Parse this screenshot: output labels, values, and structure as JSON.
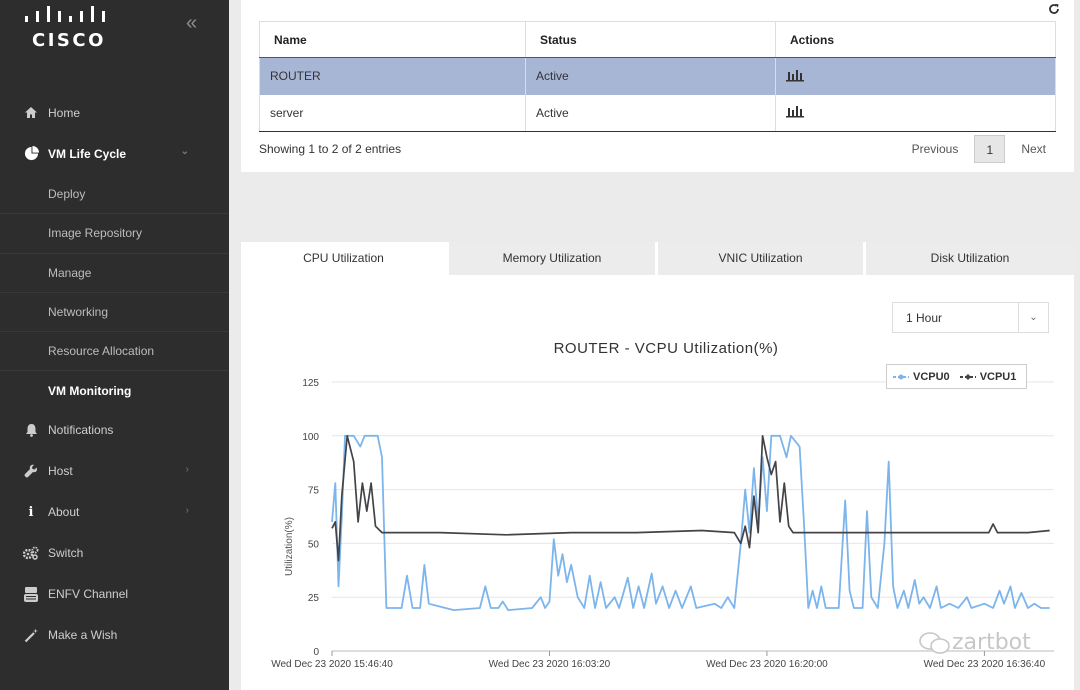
{
  "sidebar": {
    "logo_text": "CISCO",
    "collapse_glyph": "«",
    "items": [
      {
        "label": "Home",
        "icon": "home-icon"
      },
      {
        "label": "VM Life Cycle",
        "icon": "pie-chart-icon",
        "expanded": true,
        "children": [
          "Deploy",
          "Image Repository",
          "Manage",
          "Networking",
          "Resource Allocation",
          "VM Monitoring"
        ],
        "active_child": "VM Monitoring"
      },
      {
        "label": "Notifications",
        "icon": "bell-icon"
      },
      {
        "label": "Host",
        "icon": "wrench-icon",
        "has_submenu": true
      },
      {
        "label": "About",
        "icon": "info-icon",
        "has_submenu": true
      },
      {
        "label": "Switch",
        "icon": "gears-icon"
      },
      {
        "label": "ENFV Channel",
        "icon": "youtube-icon"
      },
      {
        "label": "Make a Wish",
        "icon": "magic-wand-icon"
      }
    ]
  },
  "vm_table": {
    "headers": [
      "Name",
      "Status",
      "Actions"
    ],
    "rows": [
      {
        "name": "ROUTER",
        "status": "Active",
        "selected": true
      },
      {
        "name": "server",
        "status": "Active",
        "selected": false
      }
    ],
    "showing": "Showing 1 to 2 of 2 entries",
    "pager": {
      "previous": "Previous",
      "page": "1",
      "next": "Next"
    }
  },
  "tabs": [
    {
      "label": "CPU Utilization",
      "active": true
    },
    {
      "label": "Memory Utilization",
      "active": false
    },
    {
      "label": "VNIC Utilization",
      "active": false
    },
    {
      "label": "Disk Utilization",
      "active": false
    }
  ],
  "time_range": {
    "selected": "1 Hour"
  },
  "colors": {
    "vcpu0": "#7cb5ec",
    "vcpu1": "#434348",
    "selected_row": "#a8b6d6",
    "sidebar": "#2d2d2d"
  },
  "watermark": "zartbot",
  "chart_data": {
    "type": "line",
    "title": "ROUTER - VCPU Utilization(%)",
    "ylabel": "Utilization(%)",
    "xlabel": "",
    "ylim": [
      0,
      125
    ],
    "yticks": [
      0,
      25,
      50,
      75,
      100,
      125
    ],
    "xlim": [
      "Wed Dec 23 2020 15:46:40",
      "Wed Dec 23 2020 16:42:00"
    ],
    "xticks": [
      "Wed Dec 23 2020 15:46:40",
      "Wed Dec 23 2020 16:03:20",
      "Wed Dec 23 2020 16:20:00",
      "Wed Dec 23 2020 16:36:40"
    ],
    "grid": true,
    "legend": "top-right",
    "series": [
      {
        "name": "VCPU0",
        "points": [
          [
            "Wed Dec 23 2020 15:46:40",
            60
          ],
          [
            "Wed Dec 23 2020 15:46:55",
            78
          ],
          [
            "Wed Dec 23 2020 15:47:10",
            30
          ],
          [
            "Wed Dec 23 2020 15:47:25",
            62
          ],
          [
            "Wed Dec 23 2020 15:47:40",
            100
          ],
          [
            "Wed Dec 23 2020 15:48:20",
            100
          ],
          [
            "Wed Dec 23 2020 15:48:50",
            95
          ],
          [
            "Wed Dec 23 2020 15:49:10",
            100
          ],
          [
            "Wed Dec 23 2020 15:50:10",
            100
          ],
          [
            "Wed Dec 23 2020 15:50:30",
            90
          ],
          [
            "Wed Dec 23 2020 15:50:50",
            20
          ],
          [
            "Wed Dec 23 2020 15:52:00",
            20
          ],
          [
            "Wed Dec 23 2020 15:52:25",
            35
          ],
          [
            "Wed Dec 23 2020 15:52:50",
            20
          ],
          [
            "Wed Dec 23 2020 15:53:25",
            20
          ],
          [
            "Wed Dec 23 2020 15:53:45",
            40
          ],
          [
            "Wed Dec 23 2020 15:54:05",
            22
          ],
          [
            "Wed Dec 23 2020 15:56:00",
            19
          ],
          [
            "Wed Dec 23 2020 15:58:00",
            20
          ],
          [
            "Wed Dec 23 2020 15:58:25",
            30
          ],
          [
            "Wed Dec 23 2020 15:58:50",
            20
          ],
          [
            "Wed Dec 23 2020 15:59:25",
            20
          ],
          [
            "Wed Dec 23 2020 15:59:45",
            23
          ],
          [
            "Wed Dec 23 2020 16:00:10",
            19
          ],
          [
            "Wed Dec 23 2020 16:02:00",
            20
          ],
          [
            "Wed Dec 23 2020 16:02:40",
            25
          ],
          [
            "Wed Dec 23 2020 16:03:00",
            20
          ],
          [
            "Wed Dec 23 2020 16:03:20",
            23
          ],
          [
            "Wed Dec 23 2020 16:03:40",
            52
          ],
          [
            "Wed Dec 23 2020 16:04:00",
            35
          ],
          [
            "Wed Dec 23 2020 16:04:20",
            45
          ],
          [
            "Wed Dec 23 2020 16:04:40",
            32
          ],
          [
            "Wed Dec 23 2020 16:05:00",
            40
          ],
          [
            "Wed Dec 23 2020 16:05:30",
            25
          ],
          [
            "Wed Dec 23 2020 16:06:00",
            20
          ],
          [
            "Wed Dec 23 2020 16:06:25",
            35
          ],
          [
            "Wed Dec 23 2020 16:06:50",
            20
          ],
          [
            "Wed Dec 23 2020 16:07:15",
            32
          ],
          [
            "Wed Dec 23 2020 16:07:40",
            20
          ],
          [
            "Wed Dec 23 2020 16:08:20",
            25
          ],
          [
            "Wed Dec 23 2020 16:08:40",
            20
          ],
          [
            "Wed Dec 23 2020 16:09:20",
            34
          ],
          [
            "Wed Dec 23 2020 16:09:45",
            20
          ],
          [
            "Wed Dec 23 2020 16:10:10",
            30
          ],
          [
            "Wed Dec 23 2020 16:10:35",
            20
          ],
          [
            "Wed Dec 23 2020 16:11:10",
            36
          ],
          [
            "Wed Dec 23 2020 16:11:30",
            22
          ],
          [
            "Wed Dec 23 2020 16:12:00",
            30
          ],
          [
            "Wed Dec 23 2020 16:12:30",
            20
          ],
          [
            "Wed Dec 23 2020 16:13:00",
            28
          ],
          [
            "Wed Dec 23 2020 16:13:30",
            20
          ],
          [
            "Wed Dec 23 2020 16:14:10",
            30
          ],
          [
            "Wed Dec 23 2020 16:14:35",
            20
          ],
          [
            "Wed Dec 23 2020 16:16:00",
            22
          ],
          [
            "Wed Dec 23 2020 16:16:30",
            20
          ],
          [
            "Wed Dec 23 2020 16:17:00",
            25
          ],
          [
            "Wed Dec 23 2020 16:17:30",
            20
          ],
          [
            "Wed Dec 23 2020 16:18:00",
            50
          ],
          [
            "Wed Dec 23 2020 16:18:20",
            75
          ],
          [
            "Wed Dec 23 2020 16:18:40",
            55
          ],
          [
            "Wed Dec 23 2020 16:19:00",
            85
          ],
          [
            "Wed Dec 23 2020 16:19:20",
            60
          ],
          [
            "Wed Dec 23 2020 16:19:40",
            90
          ],
          [
            "Wed Dec 23 2020 16:20:00",
            65
          ],
          [
            "Wed Dec 23 2020 16:20:20",
            100
          ],
          [
            "Wed Dec 23 2020 16:21:00",
            100
          ],
          [
            "Wed Dec 23 2020 16:21:30",
            90
          ],
          [
            "Wed Dec 23 2020 16:21:50",
            100
          ],
          [
            "Wed Dec 23 2020 16:22:30",
            95
          ],
          [
            "Wed Dec 23 2020 16:22:50",
            60
          ],
          [
            "Wed Dec 23 2020 16:23:10",
            20
          ],
          [
            "Wed Dec 23 2020 16:23:30",
            28
          ],
          [
            "Wed Dec 23 2020 16:23:50",
            20
          ],
          [
            "Wed Dec 23 2020 16:24:10",
            30
          ],
          [
            "Wed Dec 23 2020 16:24:30",
            20
          ],
          [
            "Wed Dec 23 2020 16:25:30",
            20
          ],
          [
            "Wed Dec 23 2020 16:26:00",
            70
          ],
          [
            "Wed Dec 23 2020 16:26:20",
            28
          ],
          [
            "Wed Dec 23 2020 16:26:40",
            20
          ],
          [
            "Wed Dec 23 2020 16:27:20",
            20
          ],
          [
            "Wed Dec 23 2020 16:27:40",
            65
          ],
          [
            "Wed Dec 23 2020 16:28:00",
            25
          ],
          [
            "Wed Dec 23 2020 16:28:30",
            20
          ],
          [
            "Wed Dec 23 2020 16:29:00",
            50
          ],
          [
            "Wed Dec 23 2020 16:29:20",
            88
          ],
          [
            "Wed Dec 23 2020 16:29:40",
            30
          ],
          [
            "Wed Dec 23 2020 16:30:00",
            20
          ],
          [
            "Wed Dec 23 2020 16:30:30",
            28
          ],
          [
            "Wed Dec 23 2020 16:30:50",
            20
          ],
          [
            "Wed Dec 23 2020 16:31:20",
            33
          ],
          [
            "Wed Dec 23 2020 16:31:40",
            22
          ],
          [
            "Wed Dec 23 2020 16:32:00",
            25
          ],
          [
            "Wed Dec 23 2020 16:32:30",
            20
          ],
          [
            "Wed Dec 23 2020 16:33:00",
            30
          ],
          [
            "Wed Dec 23 2020 16:33:20",
            20
          ],
          [
            "Wed Dec 23 2020 16:34:00",
            22
          ],
          [
            "Wed Dec 23 2020 16:34:40",
            20
          ],
          [
            "Wed Dec 23 2020 16:35:20",
            25
          ],
          [
            "Wed Dec 23 2020 16:35:40",
            20
          ],
          [
            "Wed Dec 23 2020 16:36:40",
            22
          ],
          [
            "Wed Dec 23 2020 16:37:20",
            20
          ],
          [
            "Wed Dec 23 2020 16:37:50",
            28
          ],
          [
            "Wed Dec 23 2020 16:38:10",
            22
          ],
          [
            "Wed Dec 23 2020 16:38:40",
            30
          ],
          [
            "Wed Dec 23 2020 16:39:00",
            20
          ],
          [
            "Wed Dec 23 2020 16:39:30",
            27
          ],
          [
            "Wed Dec 23 2020 16:40:00",
            20
          ],
          [
            "Wed Dec 23 2020 16:40:30",
            22
          ],
          [
            "Wed Dec 23 2020 16:41:00",
            20
          ],
          [
            "Wed Dec 23 2020 16:41:40",
            20
          ]
        ]
      },
      {
        "name": "VCPU1",
        "points": [
          [
            "Wed Dec 23 2020 15:46:40",
            57
          ],
          [
            "Wed Dec 23 2020 15:46:55",
            60
          ],
          [
            "Wed Dec 23 2020 15:47:10",
            42
          ],
          [
            "Wed Dec 23 2020 15:47:25",
            72
          ],
          [
            "Wed Dec 23 2020 15:47:50",
            100
          ],
          [
            "Wed Dec 23 2020 15:48:20",
            88
          ],
          [
            "Wed Dec 23 2020 15:48:40",
            60
          ],
          [
            "Wed Dec 23 2020 15:49:00",
            78
          ],
          [
            "Wed Dec 23 2020 15:49:20",
            65
          ],
          [
            "Wed Dec 23 2020 15:49:40",
            78
          ],
          [
            "Wed Dec 23 2020 15:50:00",
            58
          ],
          [
            "Wed Dec 23 2020 15:50:30",
            55
          ],
          [
            "Wed Dec 23 2020 15:55:00",
            55
          ],
          [
            "Wed Dec 23 2020 16:00:00",
            54
          ],
          [
            "Wed Dec 23 2020 16:05:00",
            55
          ],
          [
            "Wed Dec 23 2020 16:10:00",
            55
          ],
          [
            "Wed Dec 23 2020 16:15:00",
            56
          ],
          [
            "Wed Dec 23 2020 16:17:30",
            55
          ],
          [
            "Wed Dec 23 2020 16:18:00",
            50
          ],
          [
            "Wed Dec 23 2020 16:18:20",
            58
          ],
          [
            "Wed Dec 23 2020 16:18:40",
            48
          ],
          [
            "Wed Dec 23 2020 16:19:00",
            72
          ],
          [
            "Wed Dec 23 2020 16:19:20",
            55
          ],
          [
            "Wed Dec 23 2020 16:19:40",
            100
          ],
          [
            "Wed Dec 23 2020 16:20:00",
            90
          ],
          [
            "Wed Dec 23 2020 16:20:20",
            82
          ],
          [
            "Wed Dec 23 2020 16:20:40",
            88
          ],
          [
            "Wed Dec 23 2020 16:21:00",
            60
          ],
          [
            "Wed Dec 23 2020 16:21:20",
            78
          ],
          [
            "Wed Dec 23 2020 16:21:40",
            58
          ],
          [
            "Wed Dec 23 2020 16:22:00",
            55
          ],
          [
            "Wed Dec 23 2020 16:25:00",
            55
          ],
          [
            "Wed Dec 23 2020 16:30:00",
            55
          ],
          [
            "Wed Dec 23 2020 16:35:00",
            55
          ],
          [
            "Wed Dec 23 2020 16:37:00",
            55
          ],
          [
            "Wed Dec 23 2020 16:37:20",
            59
          ],
          [
            "Wed Dec 23 2020 16:37:40",
            55
          ],
          [
            "Wed Dec 23 2020 16:40:00",
            55
          ],
          [
            "Wed Dec 23 2020 16:41:40",
            56
          ]
        ]
      }
    ]
  }
}
